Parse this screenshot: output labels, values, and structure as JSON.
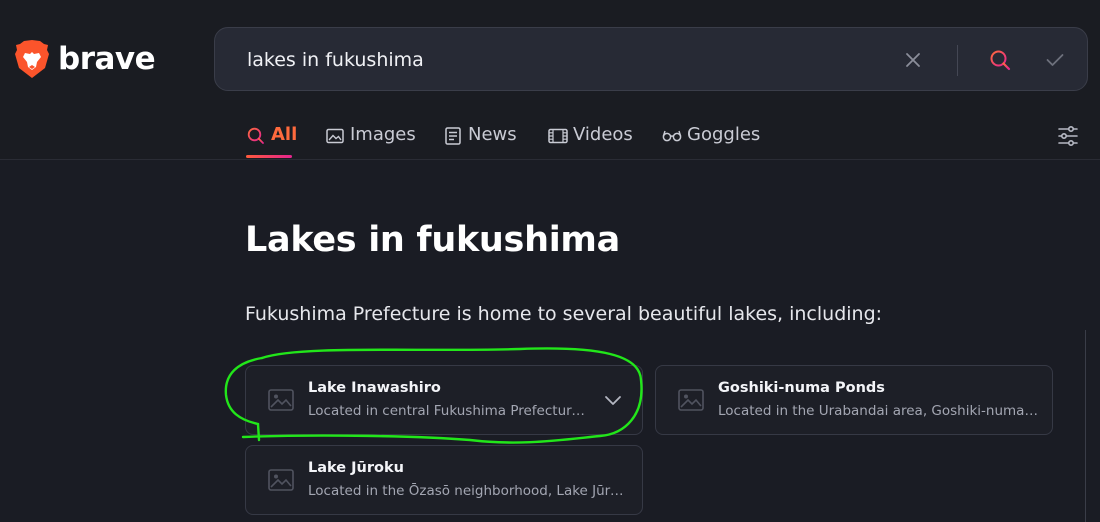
{
  "brand": {
    "name": "brave",
    "accent": "#fb542b"
  },
  "search": {
    "query": "lakes in fukushima"
  },
  "tabs": [
    {
      "label": "All",
      "icon": "search-icon",
      "active": true
    },
    {
      "label": "Images",
      "icon": "image-icon"
    },
    {
      "label": "News",
      "icon": "news-icon"
    },
    {
      "label": "Videos",
      "icon": "film-icon"
    },
    {
      "label": "Goggles",
      "icon": "goggles-icon"
    }
  ],
  "main": {
    "title": "Lakes in fukushima",
    "intro": "Fukushima Prefecture is home to several beautiful lakes, including:",
    "cards": [
      {
        "title": "Lake Inawashiro",
        "desc": "Located in central Fukushima Prefecture, Lake Inawashiro is the fourth largest lake in Japan."
      },
      {
        "title": "Goshiki-numa Ponds",
        "desc": "Located in the Urabandai area, Goshiki-numa Ponds are a group of colorful volcanic lakes."
      },
      {
        "title": "Lake Jūroku",
        "desc": "Located in the Ōzasō neighborhood, Lake Jūroku is a small lake surrounded by nature."
      }
    ]
  },
  "colors": {
    "annotation": "#22e61a",
    "background": "#1a1c24"
  }
}
